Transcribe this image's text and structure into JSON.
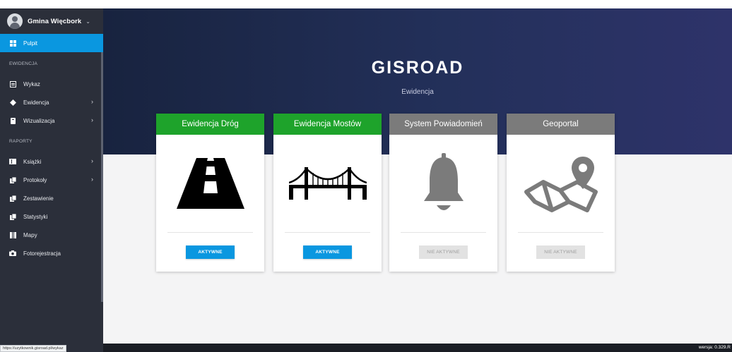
{
  "profile": {
    "name": "Gmina Więcbork",
    "caret": "⌄"
  },
  "sidebar": {
    "items": [
      {
        "label": "Pulpit",
        "icon": "dashboard-icon"
      },
      {
        "section": "EWIDENCJA"
      },
      {
        "label": "Wykaz",
        "icon": "list-icon"
      },
      {
        "label": "Ewidencja",
        "icon": "diamond-icon",
        "has_submenu": true
      },
      {
        "label": "Wizualizacja",
        "icon": "visualization-icon",
        "has_submenu": true
      },
      {
        "section": "RAPORTY"
      },
      {
        "label": "Książki",
        "icon": "book-icon",
        "has_submenu": true
      },
      {
        "label": "Protokoły",
        "icon": "copy-icon",
        "has_submenu": true
      },
      {
        "label": "Zestawienie",
        "icon": "copy-icon"
      },
      {
        "label": "Statystyki",
        "icon": "copy-icon"
      },
      {
        "label": "Mapy",
        "icon": "map-icon"
      },
      {
        "label": "Fotorejestracja",
        "icon": "camera-icon"
      }
    ],
    "chevron": "›"
  },
  "hero": {
    "title": "GISROAD",
    "subtitle": "Ewidencja"
  },
  "cards": [
    {
      "title": "Ewidencja Dróg",
      "button": "AKTYWNE",
      "active": true,
      "icon": "road-icon"
    },
    {
      "title": "Ewidencja Mostów",
      "button": "AKTYWNE",
      "active": true,
      "icon": "bridge-icon"
    },
    {
      "title": "System Powiadomień",
      "button": "NIE AKTYWNE",
      "active": false,
      "icon": "bell-icon"
    },
    {
      "title": "Geoportal",
      "button": "NIE AKTYWNE",
      "active": false,
      "icon": "map-pin-icon"
    }
  ],
  "footer": {
    "version": "wersja: 0.329.R"
  },
  "status_url": "https://uzytkownik.gisroad.pl/wykaz",
  "colors": {
    "sidebar": "#2b2f3a",
    "active": "#0a97e0",
    "green": "#1ea32b",
    "grey": "#7b7b7b"
  }
}
